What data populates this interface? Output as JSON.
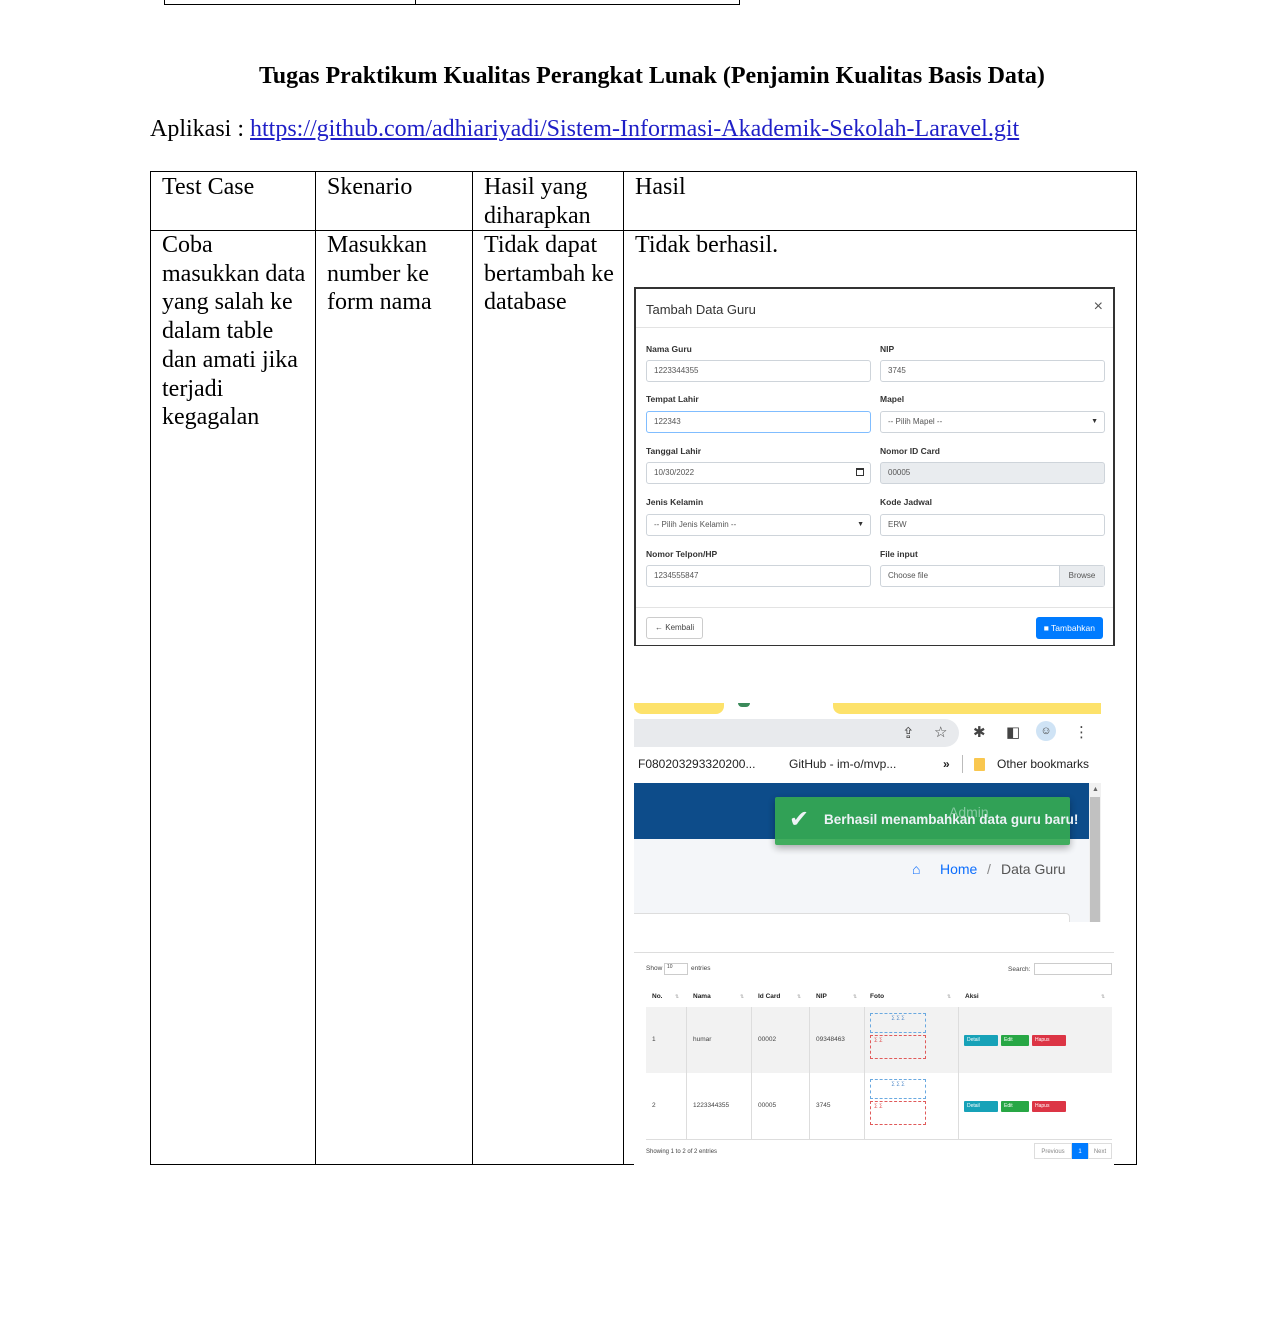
{
  "document": {
    "title": "Tugas Praktikum Kualitas Perangkat Lunak (Penjamin Kualitas Basis Data)",
    "app_label": "Aplikasi :",
    "app_url": "https://github.com/adhiariyadi/Sistem-Informasi-Akademik-Sekolah-Laravel.git"
  },
  "table": {
    "headers": [
      "Test Case",
      "Skenario",
      "Hasil yang diharapkan",
      "Hasil"
    ],
    "row": {
      "test_case": "Coba masukkan data yang salah ke dalam table dan amati jika terjadi kegagalan",
      "skenario": "Masukkan number ke form nama",
      "expected": "Tidak dapat bertambah ke database",
      "result": "Tidak berhasil."
    }
  },
  "modal": {
    "title": "Tambah Data Guru",
    "close": "×",
    "fields": {
      "nama_guru": {
        "label": "Nama Guru",
        "value": "1223344355"
      },
      "nip": {
        "label": "NIP",
        "value": "3745"
      },
      "tempat_lahir": {
        "label": "Tempat Lahir",
        "value": "122343"
      },
      "mapel": {
        "label": "Mapel",
        "value": "-- Pilih Mapel --"
      },
      "tanggal_lahir": {
        "label": "Tanggal Lahir",
        "value": "10/30/2022"
      },
      "nomor_id_card": {
        "label": "Nomor ID Card",
        "value": "00005"
      },
      "jenis_kelamin": {
        "label": "Jenis Kelamin",
        "value": "-- Pilih Jenis Kelamin --"
      },
      "kode_jadwal": {
        "label": "Kode Jadwal",
        "value": "ERW"
      },
      "nomor_telpon": {
        "label": "Nomor Telpon/HP",
        "value": "1234555847"
      },
      "file_input": {
        "label": "File input",
        "value": "Choose file",
        "browse": "Browse"
      }
    },
    "back_button": "Kembali",
    "submit_button": "Tambahkan",
    "accent_color": "#007bff"
  },
  "browser": {
    "bookmarks": [
      "F080203293320200...",
      "GitHub - im-o/mvp...",
      "»",
      "Other bookmarks"
    ],
    "toast": "Berhasil menambahkan data guru baru!",
    "toast_overlapped_text": "Admin",
    "breadcrumb": {
      "home": "Home",
      "separator": "/",
      "current": "Data Guru"
    },
    "toast_color": "#34a853",
    "header_color": "#0d4c8a"
  },
  "data_table": {
    "show_label": "Show",
    "show_value": "10",
    "entries_label": "entries",
    "search_label": "Search:",
    "columns": [
      "No.",
      "Nama",
      "Id Card",
      "NIP",
      "Foto",
      "Aksi"
    ],
    "rows": [
      {
        "no": "1",
        "nama": "humar",
        "id_card": "00002",
        "nip": "09348463"
      },
      {
        "no": "2",
        "nama": "1223344355",
        "id_card": "00005",
        "nip": "3745"
      }
    ],
    "actions": [
      "Detail",
      "Edit",
      "Hapus"
    ],
    "info": "Showing 1 to 2 of 2 entries",
    "pagination": [
      "Previous",
      "1",
      "Next"
    ]
  }
}
